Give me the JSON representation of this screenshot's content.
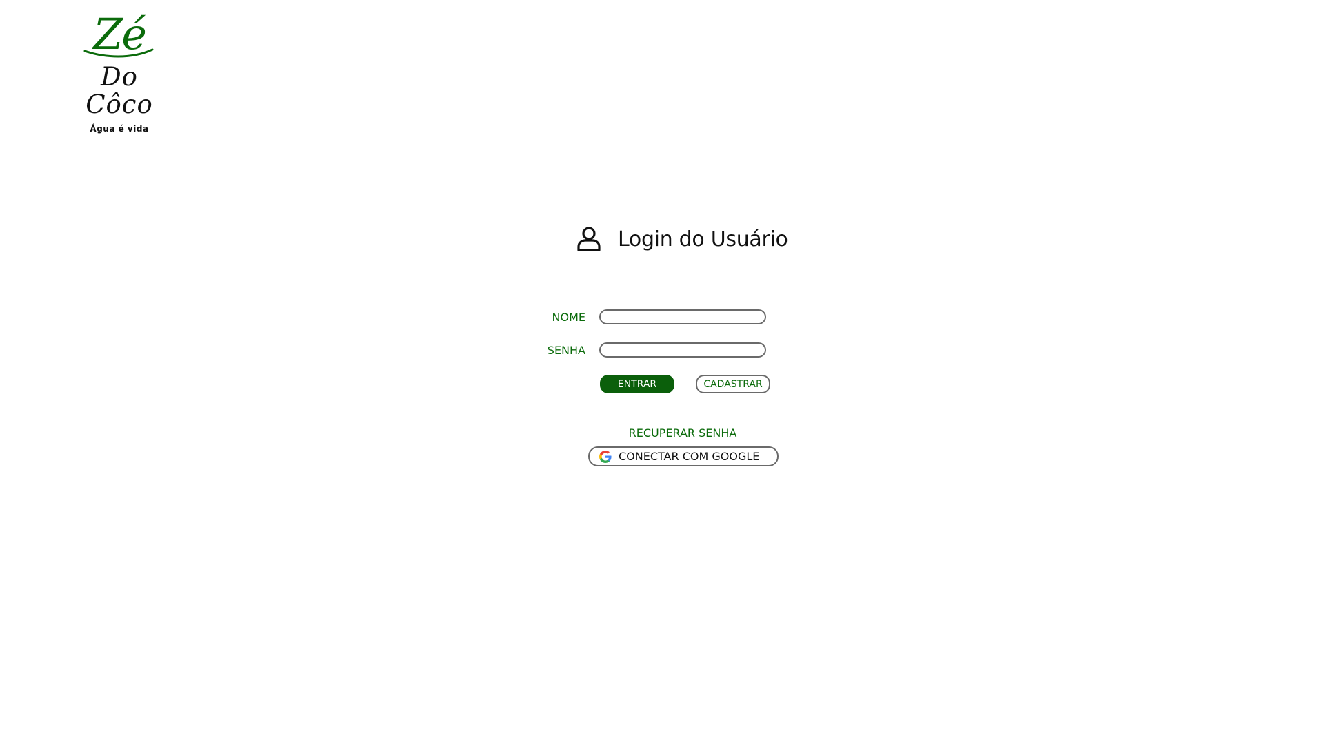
{
  "logo": {
    "line1": "Zé",
    "line2": "Do Côco",
    "tagline": "Água é vida"
  },
  "login": {
    "title": "Login do Usuário",
    "icon": "user-icon"
  },
  "form": {
    "name_label": "NOME",
    "name_value": "",
    "password_label": "SENHA",
    "password_value": "",
    "enter_button": "ENTRAR",
    "register_button": "CADASTRAR",
    "recover_link": "RECUPERAR SENHA",
    "google_button": "CONECTAR COM GOOGLE",
    "google_icon": "google-icon"
  },
  "colors": {
    "brand_green": "#0b6b0b",
    "button_green": "#0b5f0b",
    "border_gray": "#6a6a6a",
    "text_dark": "#111111"
  }
}
